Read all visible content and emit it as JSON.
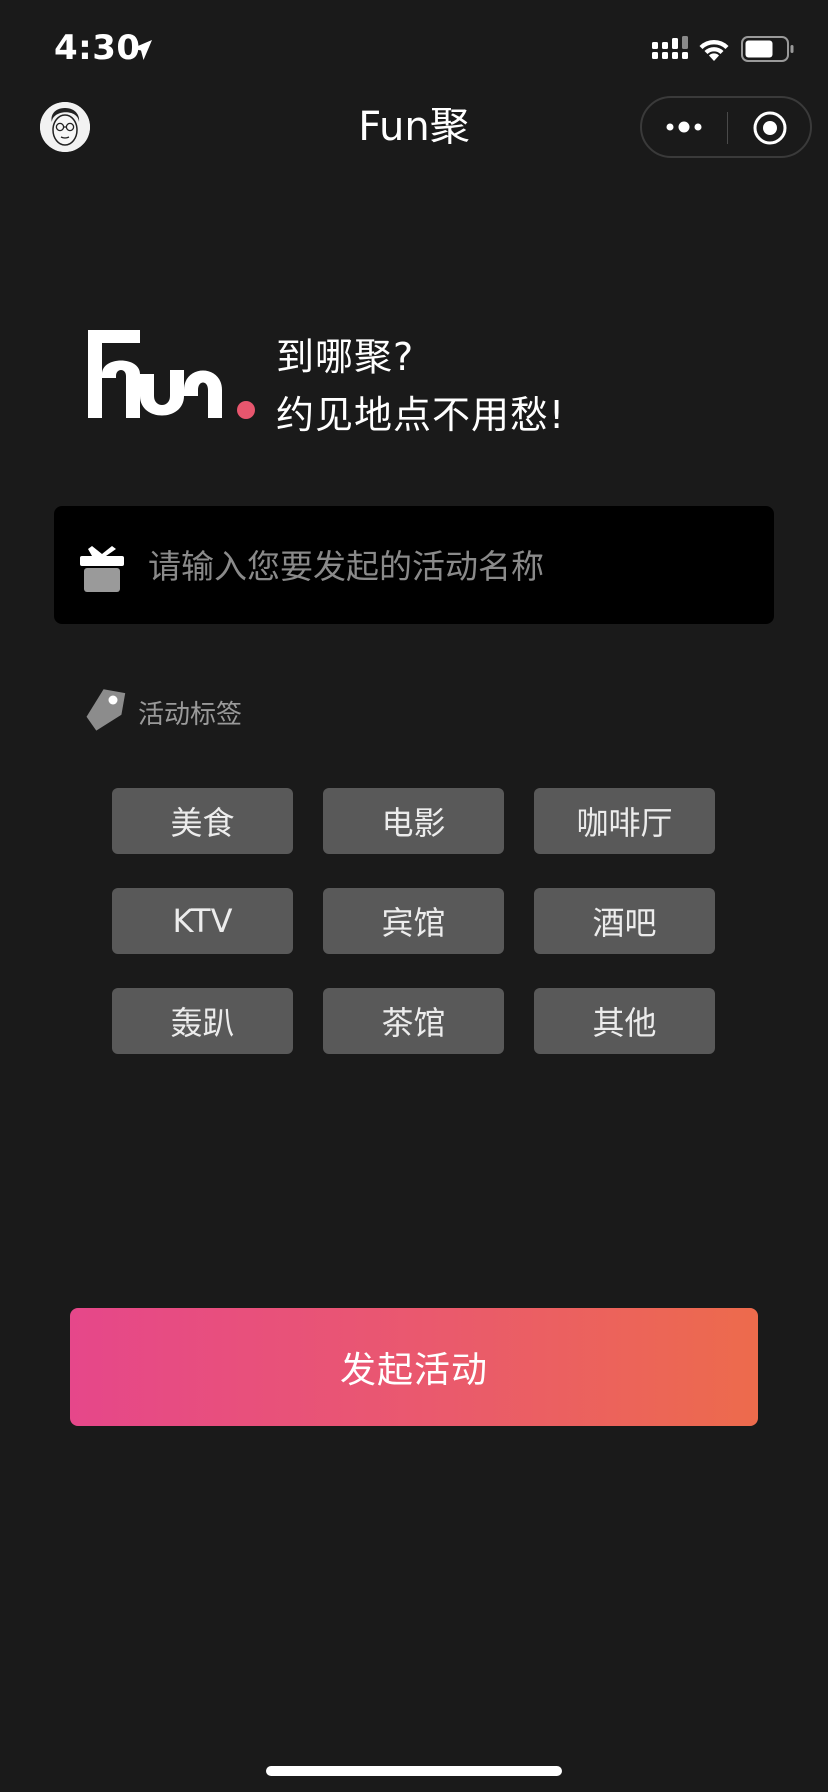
{
  "status_bar": {
    "time": "4:30"
  },
  "nav": {
    "title": "Fun聚"
  },
  "hero": {
    "line1": "到哪聚?",
    "line2": "约见地点不用愁!",
    "logo_accent_color": "#e8566e"
  },
  "activity_input": {
    "value": "",
    "placeholder": "请输入您要发起的活动名称"
  },
  "tags": {
    "label": "活动标签",
    "items": [
      "美食",
      "电影",
      "咖啡厅",
      "KTV",
      "宾馆",
      "酒吧",
      "轰趴",
      "茶馆",
      "其他"
    ]
  },
  "launch_button": {
    "label": "发起活动",
    "gradient": [
      "#e6478a",
      "#ed6b4c"
    ]
  },
  "colors": {
    "background": "#1a1a1a",
    "input_background": "#000000",
    "tag_background": "#595959"
  },
  "icons": {
    "location": "location-arrow-icon",
    "signal": "cellular-signal-icon",
    "wifi": "wifi-icon",
    "battery": "battery-icon",
    "more": "more-dots-icon",
    "close": "close-miniprogram-icon",
    "gift": "gift-icon",
    "tag": "tag-icon"
  }
}
